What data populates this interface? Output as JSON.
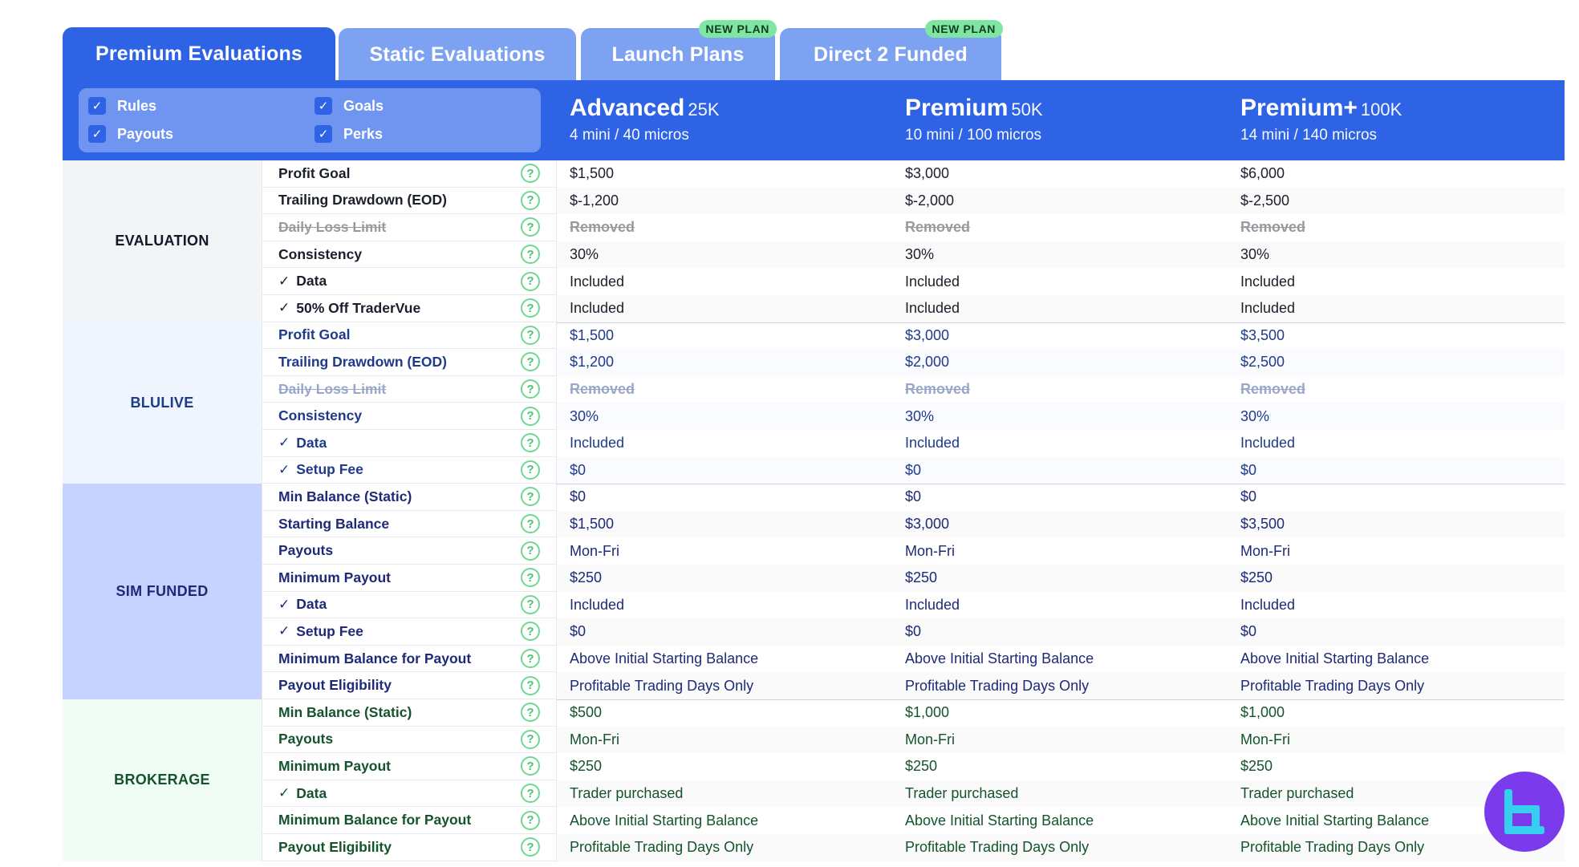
{
  "tabs": [
    {
      "label": "Premium Evaluations",
      "badge": ""
    },
    {
      "label": "Static Evaluations",
      "badge": ""
    },
    {
      "label": "Launch Plans",
      "badge": "NEW PLAN"
    },
    {
      "label": "Direct 2 Funded",
      "badge": "NEW PLAN"
    }
  ],
  "filters": {
    "rules": "Rules",
    "goals": "Goals",
    "payouts": "Payouts",
    "perks": "Perks",
    "check_glyph": "✓"
  },
  "plans": [
    {
      "name": "Advanced",
      "size": "25K",
      "sub": "4 mini / 40 micros"
    },
    {
      "name": "Premium",
      "size": "50K",
      "sub": "10 mini / 100 micros"
    },
    {
      "name": "Premium+",
      "size": "100K",
      "sub": "14 mini / 140 micros"
    }
  ],
  "help_glyph": "?",
  "sections": {
    "evaluation": {
      "label": "EVALUATION",
      "rows": [
        {
          "feature": "Profit Goal",
          "values": [
            "$1,500",
            "$3,000",
            "$6,000"
          ]
        },
        {
          "feature": "Trailing Drawdown (EOD)",
          "values": [
            "$-1,200",
            "$-2,000",
            "$-2,500"
          ]
        },
        {
          "feature": "Daily Loss Limit",
          "values": [
            "Removed",
            "Removed",
            "Removed"
          ]
        },
        {
          "feature": "Consistency",
          "values": [
            "30%",
            "30%",
            "30%"
          ]
        },
        {
          "feature": "Data",
          "values": [
            "Included",
            "Included",
            "Included"
          ]
        },
        {
          "feature": "50% Off TraderVue",
          "values": [
            "Included",
            "Included",
            "Included"
          ]
        }
      ]
    },
    "blulive": {
      "label": "BLULIVE",
      "rows": [
        {
          "feature": "Profit Goal",
          "values": [
            "$1,500",
            "$3,000",
            "$3,500"
          ]
        },
        {
          "feature": "Trailing Drawdown (EOD)",
          "values": [
            "$1,200",
            "$2,000",
            "$2,500"
          ]
        },
        {
          "feature": "Daily Loss Limit",
          "values": [
            "Removed",
            "Removed",
            "Removed"
          ]
        },
        {
          "feature": "Consistency",
          "values": [
            "30%",
            "30%",
            "30%"
          ]
        },
        {
          "feature": "Data",
          "values": [
            "Included",
            "Included",
            "Included"
          ]
        },
        {
          "feature": "Setup Fee",
          "values": [
            "$0",
            "$0",
            "$0"
          ]
        }
      ]
    },
    "sim_funded": {
      "label": "SIM FUNDED",
      "rows": [
        {
          "feature": "Min Balance (Static)",
          "values": [
            "$0",
            "$0",
            "$0"
          ]
        },
        {
          "feature": "Starting Balance",
          "values": [
            "$1,500",
            "$3,000",
            "$3,500"
          ]
        },
        {
          "feature": "Payouts",
          "values": [
            "Mon-Fri",
            "Mon-Fri",
            "Mon-Fri"
          ]
        },
        {
          "feature": "Minimum Payout",
          "values": [
            "$250",
            "$250",
            "$250"
          ]
        },
        {
          "feature": "Data",
          "values": [
            "Included",
            "Included",
            "Included"
          ]
        },
        {
          "feature": "Setup Fee",
          "values": [
            "$0",
            "$0",
            "$0"
          ]
        },
        {
          "feature": "Minimum Balance for Payout",
          "values": [
            "Above Initial Starting Balance",
            "Above Initial Starting Balance",
            "Above Initial Starting Balance"
          ]
        },
        {
          "feature": "Payout Eligibility",
          "values": [
            "Profitable Trading Days Only",
            "Profitable Trading Days Only",
            "Profitable Trading Days Only"
          ]
        }
      ]
    },
    "brokerage": {
      "label": "BROKERAGE",
      "rows": [
        {
          "feature": "Min Balance (Static)",
          "values": [
            "$500",
            "$1,000",
            "$1,000"
          ]
        },
        {
          "feature": "Payouts",
          "values": [
            "Mon-Fri",
            "Mon-Fri",
            "Mon-Fri"
          ]
        },
        {
          "feature": "Minimum Payout",
          "values": [
            "$250",
            "$250",
            "$250"
          ]
        },
        {
          "feature": "Data",
          "values": [
            "Trader purchased",
            "Trader purchased",
            "Trader purchased"
          ]
        },
        {
          "feature": "Minimum Balance for Payout",
          "values": [
            "Above Initial Starting Balance",
            "Above Initial Starting Balance",
            "Above Initial Starting Balance"
          ]
        },
        {
          "feature": "Payout Eligibility",
          "values": [
            "Profitable Trading Days Only",
            "Profitable Trading Days Only",
            "Profitable Trading Days Only"
          ]
        }
      ]
    }
  },
  "check_glyph": "✓",
  "logo_icon": "brand-logo-icon"
}
